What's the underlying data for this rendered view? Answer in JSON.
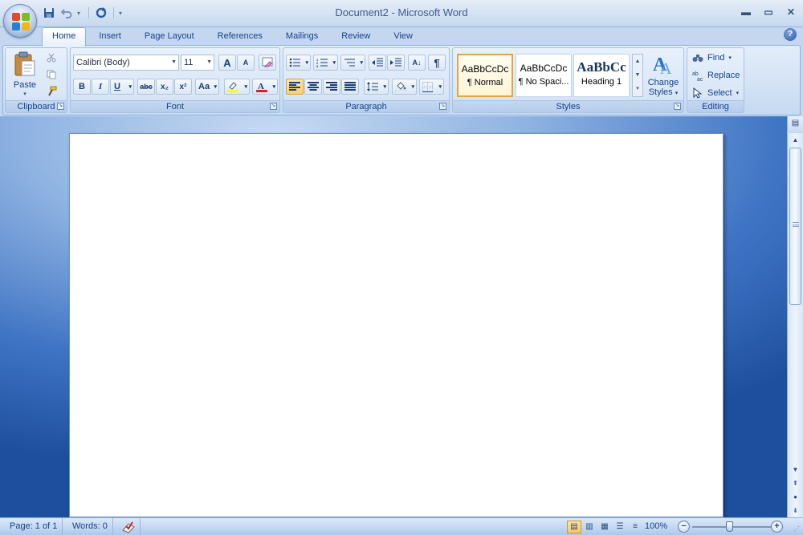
{
  "app": {
    "title": "Document2 - Microsoft Word",
    "window_controls": {
      "minimize": "▬",
      "maximize": "▭",
      "close": "✕"
    }
  },
  "quick_access": {
    "save_icon": "save-icon",
    "undo_icon": "undo-icon",
    "redo_icon": "redo-icon",
    "customize_icon": "customize-toolbar-icon"
  },
  "tabs": [
    "Home",
    "Insert",
    "Page Layout",
    "References",
    "Mailings",
    "Review",
    "View"
  ],
  "active_tab": "Home",
  "help": "?",
  "ribbon": {
    "clipboard": {
      "label": "Clipboard",
      "paste_label": "Paste"
    },
    "font": {
      "label": "Font",
      "font_name": "Calibri (Body)",
      "font_size": "11",
      "bold": "B",
      "italic": "I",
      "underline": "U",
      "strikethrough": "abc",
      "subscript": "x₂",
      "superscript": "x²",
      "change_case": "Aa",
      "grow_font": "A",
      "shrink_font": "A",
      "font_color_accent": "#e02020",
      "highlight_accent": "#ffff00"
    },
    "paragraph": {
      "label": "Paragraph",
      "sort": "A↓",
      "show_marks": "¶"
    },
    "styles": {
      "label": "Styles",
      "tiles": [
        {
          "sample": "AaBbCcDc",
          "name": "¶ Normal"
        },
        {
          "sample": "AaBbCcDc",
          "name": "¶ No Spaci..."
        },
        {
          "sample": "AaBbCc",
          "name": "Heading 1"
        }
      ],
      "change_styles_line1": "Change",
      "change_styles_line2": "Styles"
    },
    "editing": {
      "label": "Editing",
      "find": "Find",
      "replace": "Replace",
      "select": "Select"
    }
  },
  "statusbar": {
    "page": "Page: 1 of 1",
    "words": "Words: 0",
    "zoom": "100%",
    "zoom_level_percent": 100
  },
  "colors": {
    "ribbon_text": "#15428b",
    "selected_style_border": "#e2a540"
  }
}
